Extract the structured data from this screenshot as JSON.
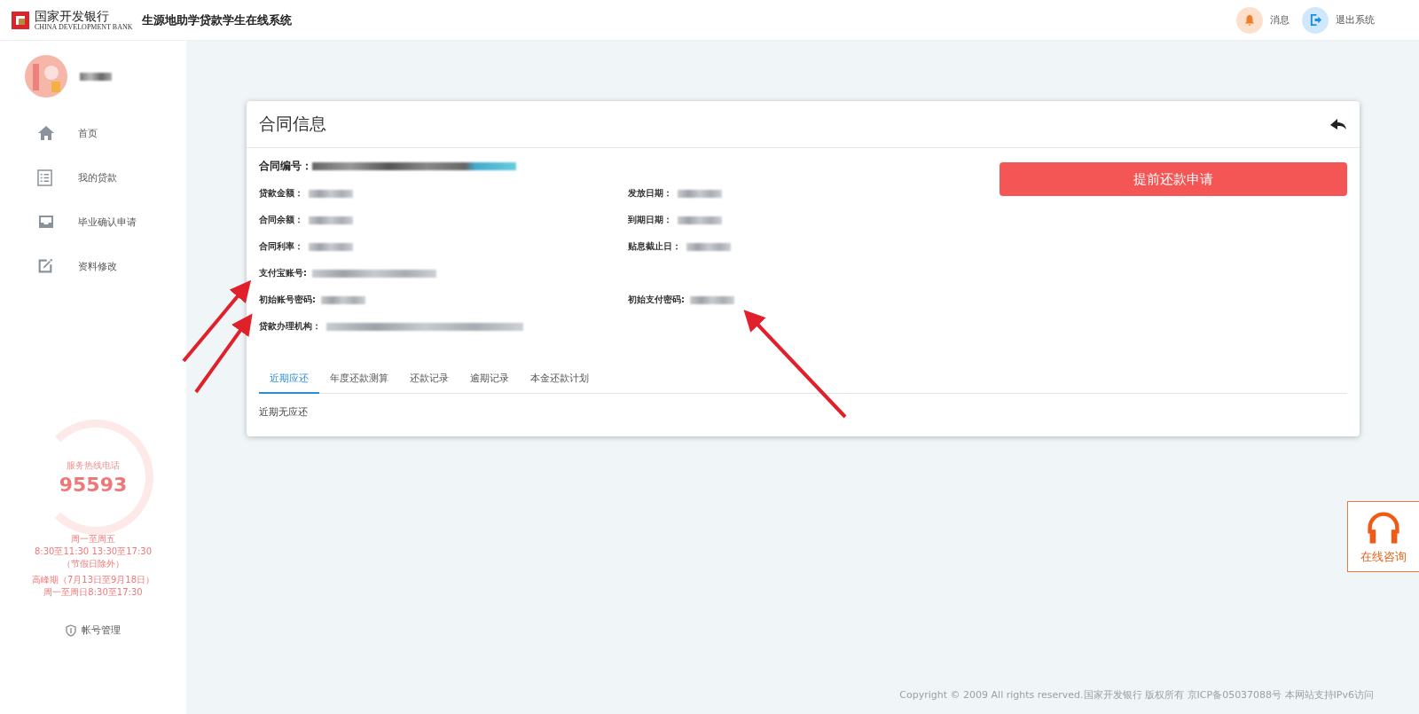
{
  "header": {
    "logo": {
      "name": "国家开发银行",
      "subtitle": "CHINA DEVELOPMENT BANK"
    },
    "title": "生源地助学贷款学生在线系统",
    "actions": [
      {
        "kind": "bell",
        "label": "消息"
      },
      {
        "kind": "logout",
        "label": "退出系统"
      }
    ]
  },
  "sidebar": {
    "nav": [
      {
        "kind": "home",
        "label": "首页"
      },
      {
        "kind": "list",
        "label": "我的贷款"
      },
      {
        "kind": "tray",
        "label": "毕业确认申请"
      },
      {
        "kind": "edit",
        "label": "资料修改"
      }
    ],
    "hotline": {
      "title": "服务热线电话",
      "number": "95593",
      "hours": [
        "周一至周五",
        "8:30至11:30 13:30至17:30",
        "（节假日除外）",
        "高峰期（7月13日至9月18日）",
        "周一至周日8:30至17:30"
      ]
    },
    "account": {
      "label": "帐号管理"
    }
  },
  "card": {
    "title": "合同信息",
    "contract_label": "合同编号：",
    "action_button": "提前还款申请",
    "rows": [
      {
        "left": {
          "label": "贷款金额：",
          "kind": "short"
        },
        "right": {
          "label": "发放日期：",
          "kind": "short"
        }
      },
      {
        "left": {
          "label": "合同余额：",
          "kind": "short"
        },
        "right": {
          "label": "到期日期：",
          "kind": "short"
        }
      },
      {
        "left": {
          "label": "合同利率：",
          "kind": "short"
        },
        "right": {
          "label": "贴息截止日：",
          "kind": "short"
        }
      },
      {
        "left": {
          "label": "支付宝账号:",
          "kind": "medium"
        }
      },
      {
        "left": {
          "label": "初始账号密码:",
          "kind": "short"
        },
        "right": {
          "label": "初始支付密码:",
          "kind": "short"
        }
      },
      {
        "left": {
          "label": "贷款办理机构：",
          "kind": "long"
        }
      }
    ],
    "tabs": [
      {
        "label": "近期应还",
        "selected": true
      },
      {
        "label": "年度还款测算",
        "selected": false
      },
      {
        "label": "还款记录",
        "selected": false
      },
      {
        "label": "逾期记录",
        "selected": false
      },
      {
        "label": "本金还款计划",
        "selected": false
      }
    ],
    "tab_content": "近期无应还"
  },
  "consult": {
    "label": "在线咨询"
  },
  "copyright": "Copyright © 2009 All rights reserved.国家开发银行 版权所有 京ICP备05037088号 本网站支持IPv6访问"
}
